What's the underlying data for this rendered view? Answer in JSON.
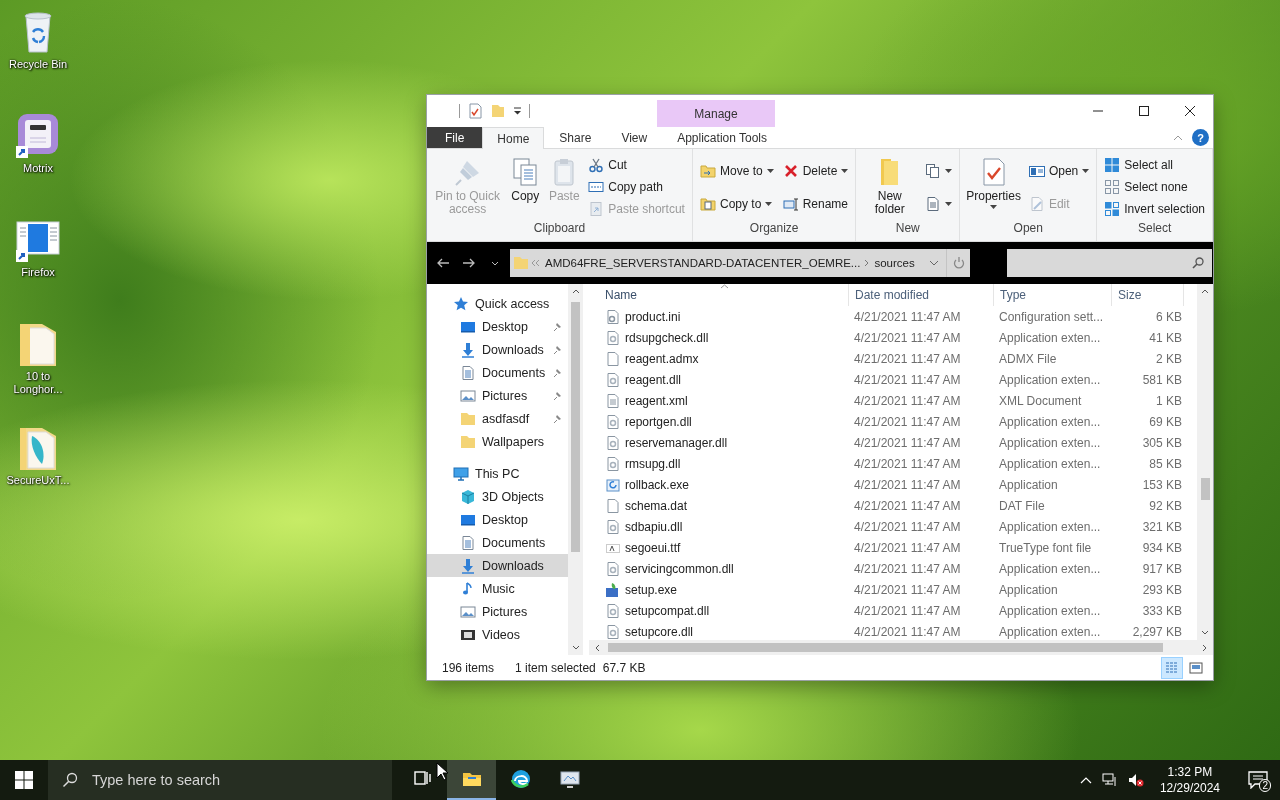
{
  "desktop_icons": [
    {
      "label": "Recycle Bin",
      "kind": "recycle",
      "shortcut": false
    },
    {
      "label": "Motrix",
      "kind": "app",
      "shortcut": true
    },
    {
      "label": "Firefox",
      "kind": "window",
      "shortcut": true
    },
    {
      "label": "10 to Longhor...",
      "kind": "folder",
      "shortcut": false
    },
    {
      "label": "SecureUxT...",
      "kind": "folderdoc",
      "shortcut": false
    }
  ],
  "explorer": {
    "contextual_tab": "Manage",
    "tabs": [
      {
        "label": "File",
        "kind": "file",
        "selected": false
      },
      {
        "label": "Home",
        "kind": "tab",
        "selected": true
      },
      {
        "label": "Share",
        "kind": "tab",
        "selected": false
      },
      {
        "label": "View",
        "kind": "tab",
        "selected": false
      },
      {
        "label": "Application Tools",
        "kind": "tab",
        "selected": false
      }
    ],
    "help": "?",
    "ribbon_groups": [
      {
        "label": "Clipboard",
        "commands": [
          {
            "kind": "large",
            "label": "Pin to Quick access",
            "disabled": true
          },
          {
            "kind": "large",
            "label": "Copy",
            "disabled": false
          },
          {
            "kind": "large",
            "label": "Paste",
            "disabled": true
          },
          {
            "kind": "stack",
            "items": [
              {
                "label": "Cut",
                "disabled": false
              },
              {
                "label": "Copy path",
                "disabled": false
              },
              {
                "label": "Paste shortcut",
                "disabled": true
              }
            ]
          }
        ]
      },
      {
        "label": "Organize",
        "commands": [
          {
            "kind": "stack",
            "items": [
              {
                "label": "Move to",
                "dropdown": true,
                "disabled": false
              },
              {
                "label": "Copy to",
                "dropdown": true,
                "disabled": false
              }
            ]
          },
          {
            "kind": "stack",
            "items": [
              {
                "label": "Delete",
                "dropdown": true,
                "disabled": false
              },
              {
                "label": "Rename",
                "disabled": false
              }
            ]
          }
        ]
      },
      {
        "label": "New",
        "commands": [
          {
            "kind": "large",
            "label": "New folder",
            "disabled": false
          },
          {
            "kind": "stack",
            "items": [
              {
                "dropdown": true,
                "disabled": false
              },
              {
                "dropdown": true,
                "disabled": false
              }
            ]
          }
        ]
      },
      {
        "label": "Open",
        "commands": [
          {
            "kind": "large",
            "label": "Properties",
            "dropdown": true,
            "disabled": false
          },
          {
            "kind": "stack",
            "items": [
              {
                "label": "Open",
                "dropdown": true,
                "disabled": false
              },
              {
                "label": "Edit",
                "disabled": true
              }
            ]
          }
        ]
      },
      {
        "label": "Select",
        "commands": [
          {
            "kind": "stack",
            "items": [
              {
                "label": "Select all",
                "disabled": false
              },
              {
                "label": "Select none",
                "disabled": false
              },
              {
                "label": "Invert selection",
                "disabled": false
              }
            ]
          }
        ]
      }
    ],
    "address_path": [
      "AMD64FRE_SERVERSTANDARD-DATACENTER_OEMRE...",
      "sources"
    ],
    "nav": [
      {
        "label": "Quick access",
        "kind": "star",
        "selected": false,
        "children": [
          {
            "label": "Desktop",
            "kind": "desktop",
            "pinned": true,
            "selected": false
          },
          {
            "label": "Downloads",
            "kind": "downloads",
            "pinned": true,
            "selected": false
          },
          {
            "label": "Documents",
            "kind": "documents",
            "pinned": true,
            "selected": false
          },
          {
            "label": "Pictures",
            "kind": "pictures",
            "pinned": true,
            "selected": false
          },
          {
            "label": "asdfasdf",
            "kind": "folder",
            "pinned": true,
            "selected": false
          },
          {
            "label": "Wallpapers",
            "kind": "folder",
            "pinned": false,
            "selected": false
          }
        ]
      },
      {
        "label": "This PC",
        "kind": "pc",
        "selected": false,
        "children": [
          {
            "label": "3D Objects",
            "kind": "cube",
            "pinned": false,
            "selected": false
          },
          {
            "label": "Desktop",
            "kind": "desktop",
            "pinned": false,
            "selected": false
          },
          {
            "label": "Documents",
            "kind": "documents",
            "pinned": false,
            "selected": false
          },
          {
            "label": "Downloads",
            "kind": "downloads",
            "pinned": false,
            "selected": true
          },
          {
            "label": "Music",
            "kind": "music",
            "pinned": false,
            "selected": false
          },
          {
            "label": "Pictures",
            "kind": "pictures",
            "pinned": false,
            "selected": false
          },
          {
            "label": "Videos",
            "kind": "videos",
            "pinned": false,
            "selected": false
          }
        ]
      }
    ],
    "columns": [
      {
        "label": "Name",
        "sorted": true
      },
      {
        "label": "Date modified",
        "sorted": false
      },
      {
        "label": "Type",
        "sorted": false
      },
      {
        "label": "Size",
        "sorted": false
      }
    ],
    "files": [
      {
        "name": "product.ini",
        "kind": "ini",
        "date": "4/21/2021 11:47 AM",
        "type": "Configuration sett...",
        "size": "6 KB"
      },
      {
        "name": "rdsupgcheck.dll",
        "kind": "dll",
        "date": "4/21/2021 11:47 AM",
        "type": "Application exten...",
        "size": "41 KB"
      },
      {
        "name": "reagent.admx",
        "kind": "blank",
        "date": "4/21/2021 11:47 AM",
        "type": "ADMX File",
        "size": "2 KB"
      },
      {
        "name": "reagent.dll",
        "kind": "dll",
        "date": "4/21/2021 11:47 AM",
        "type": "Application exten...",
        "size": "581 KB"
      },
      {
        "name": "reagent.xml",
        "kind": "xml",
        "date": "4/21/2021 11:47 AM",
        "type": "XML Document",
        "size": "1 KB"
      },
      {
        "name": "reportgen.dll",
        "kind": "dll",
        "date": "4/21/2021 11:47 AM",
        "type": "Application exten...",
        "size": "69 KB"
      },
      {
        "name": "reservemanager.dll",
        "kind": "dll",
        "date": "4/21/2021 11:47 AM",
        "type": "Application exten...",
        "size": "305 KB"
      },
      {
        "name": "rmsupg.dll",
        "kind": "dll",
        "date": "4/21/2021 11:47 AM",
        "type": "Application exten...",
        "size": "85 KB"
      },
      {
        "name": "rollback.exe",
        "kind": "exe",
        "date": "4/21/2021 11:47 AM",
        "type": "Application",
        "size": "153 KB"
      },
      {
        "name": "schema.dat",
        "kind": "blank",
        "date": "4/21/2021 11:47 AM",
        "type": "DAT File",
        "size": "92 KB"
      },
      {
        "name": "sdbapiu.dll",
        "kind": "dll",
        "date": "4/21/2021 11:47 AM",
        "type": "Application exten...",
        "size": "321 KB"
      },
      {
        "name": "segoeui.ttf",
        "kind": "ttf",
        "date": "4/21/2021 11:47 AM",
        "type": "TrueType font file",
        "size": "934 KB"
      },
      {
        "name": "servicingcommon.dll",
        "kind": "dll",
        "date": "4/21/2021 11:47 AM",
        "type": "Application exten...",
        "size": "917 KB"
      },
      {
        "name": "setup.exe",
        "kind": "setup",
        "date": "4/21/2021 11:47 AM",
        "type": "Application",
        "size": "293 KB"
      },
      {
        "name": "setupcompat.dll",
        "kind": "dll",
        "date": "4/21/2021 11:47 AM",
        "type": "Application exten...",
        "size": "333 KB"
      },
      {
        "name": "setupcore.dll",
        "kind": "dll",
        "date": "4/21/2021 11:47 AM",
        "type": "Application exten...",
        "size": "2,297 KB"
      }
    ],
    "status": {
      "item_count": "196 items",
      "selection": "1 item selected",
      "selection_size": "67.7 KB"
    },
    "view_buttons": [
      {
        "kind": "details",
        "selected": true
      },
      {
        "kind": "large_icons",
        "selected": false
      }
    ]
  },
  "taskbar": {
    "search_placeholder": "Type here to search",
    "apps": [
      {
        "kind": "taskview",
        "active": false
      },
      {
        "kind": "explorer",
        "active": true
      },
      {
        "kind": "edge",
        "active": false
      },
      {
        "kind": "app",
        "active": false
      }
    ],
    "time": "1:32 PM",
    "date": "12/29/2024",
    "notification_count": "2"
  }
}
